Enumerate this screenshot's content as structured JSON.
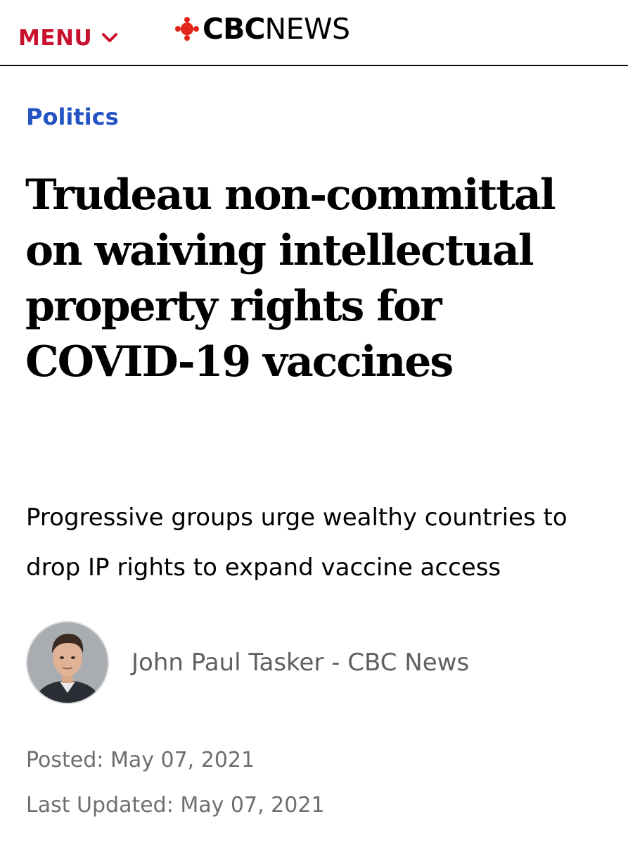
{
  "header": {
    "menu_label": "MENU",
    "logo_brand": "CBC",
    "logo_section": "NEWS",
    "accent_color": "#c8102e"
  },
  "article": {
    "category": "Politics",
    "category_color": "#2454c4",
    "headline": "Trudeau non-committal on waiving intellectual property rights for COVID-19 vaccines",
    "deck": "Progressive groups urge wealthy countries to drop IP rights to expand vaccine access",
    "author": "John Paul Tasker - CBC News",
    "posted_label": "Posted:",
    "posted_date": "May 07, 2021",
    "updated_label": "Last Updated:",
    "updated_date": "May 07, 2021"
  }
}
